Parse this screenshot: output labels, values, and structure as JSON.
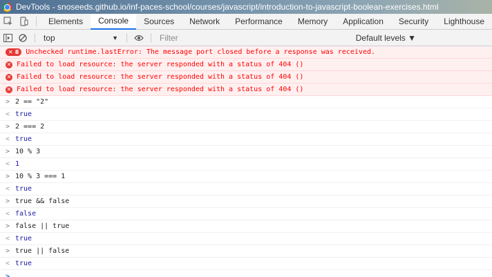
{
  "title_bar": {
    "text": "DevTools - snoseeds.github.io/inf-paces-school/courses/javascript/introduction-to-javascript-boolean-exercises.html"
  },
  "tabs": [
    "Elements",
    "Console",
    "Sources",
    "Network",
    "Performance",
    "Memory",
    "Application",
    "Security",
    "Lighthouse"
  ],
  "active_tab": "Console",
  "toolbar": {
    "context": "top",
    "filter_placeholder": "Filter",
    "levels": "Default levels ▼"
  },
  "errors": [
    {
      "count": "8",
      "text": "Unchecked runtime.lastError: The message port closed before a response was received."
    },
    {
      "text": "Failed to load resource: the server responded with a status of 404 ()"
    },
    {
      "text": "Failed to load resource: the server responded with a status of 404 ()"
    },
    {
      "text": "Failed to load resource: the server responded with a status of 404 ()"
    }
  ],
  "entries": [
    {
      "input": "2 == \"2\"",
      "output": "true"
    },
    {
      "input": "2 === 2",
      "output": "true"
    },
    {
      "input": "10 % 3",
      "output": "1"
    },
    {
      "input": "10 % 3 === 1",
      "output": "true"
    },
    {
      "input": "true && false",
      "output": "false"
    },
    {
      "input": "false || true",
      "output": "true"
    },
    {
      "input": "true || false",
      "output": "true"
    }
  ],
  "prompt_symbol": ">",
  "return_symbol": "<"
}
